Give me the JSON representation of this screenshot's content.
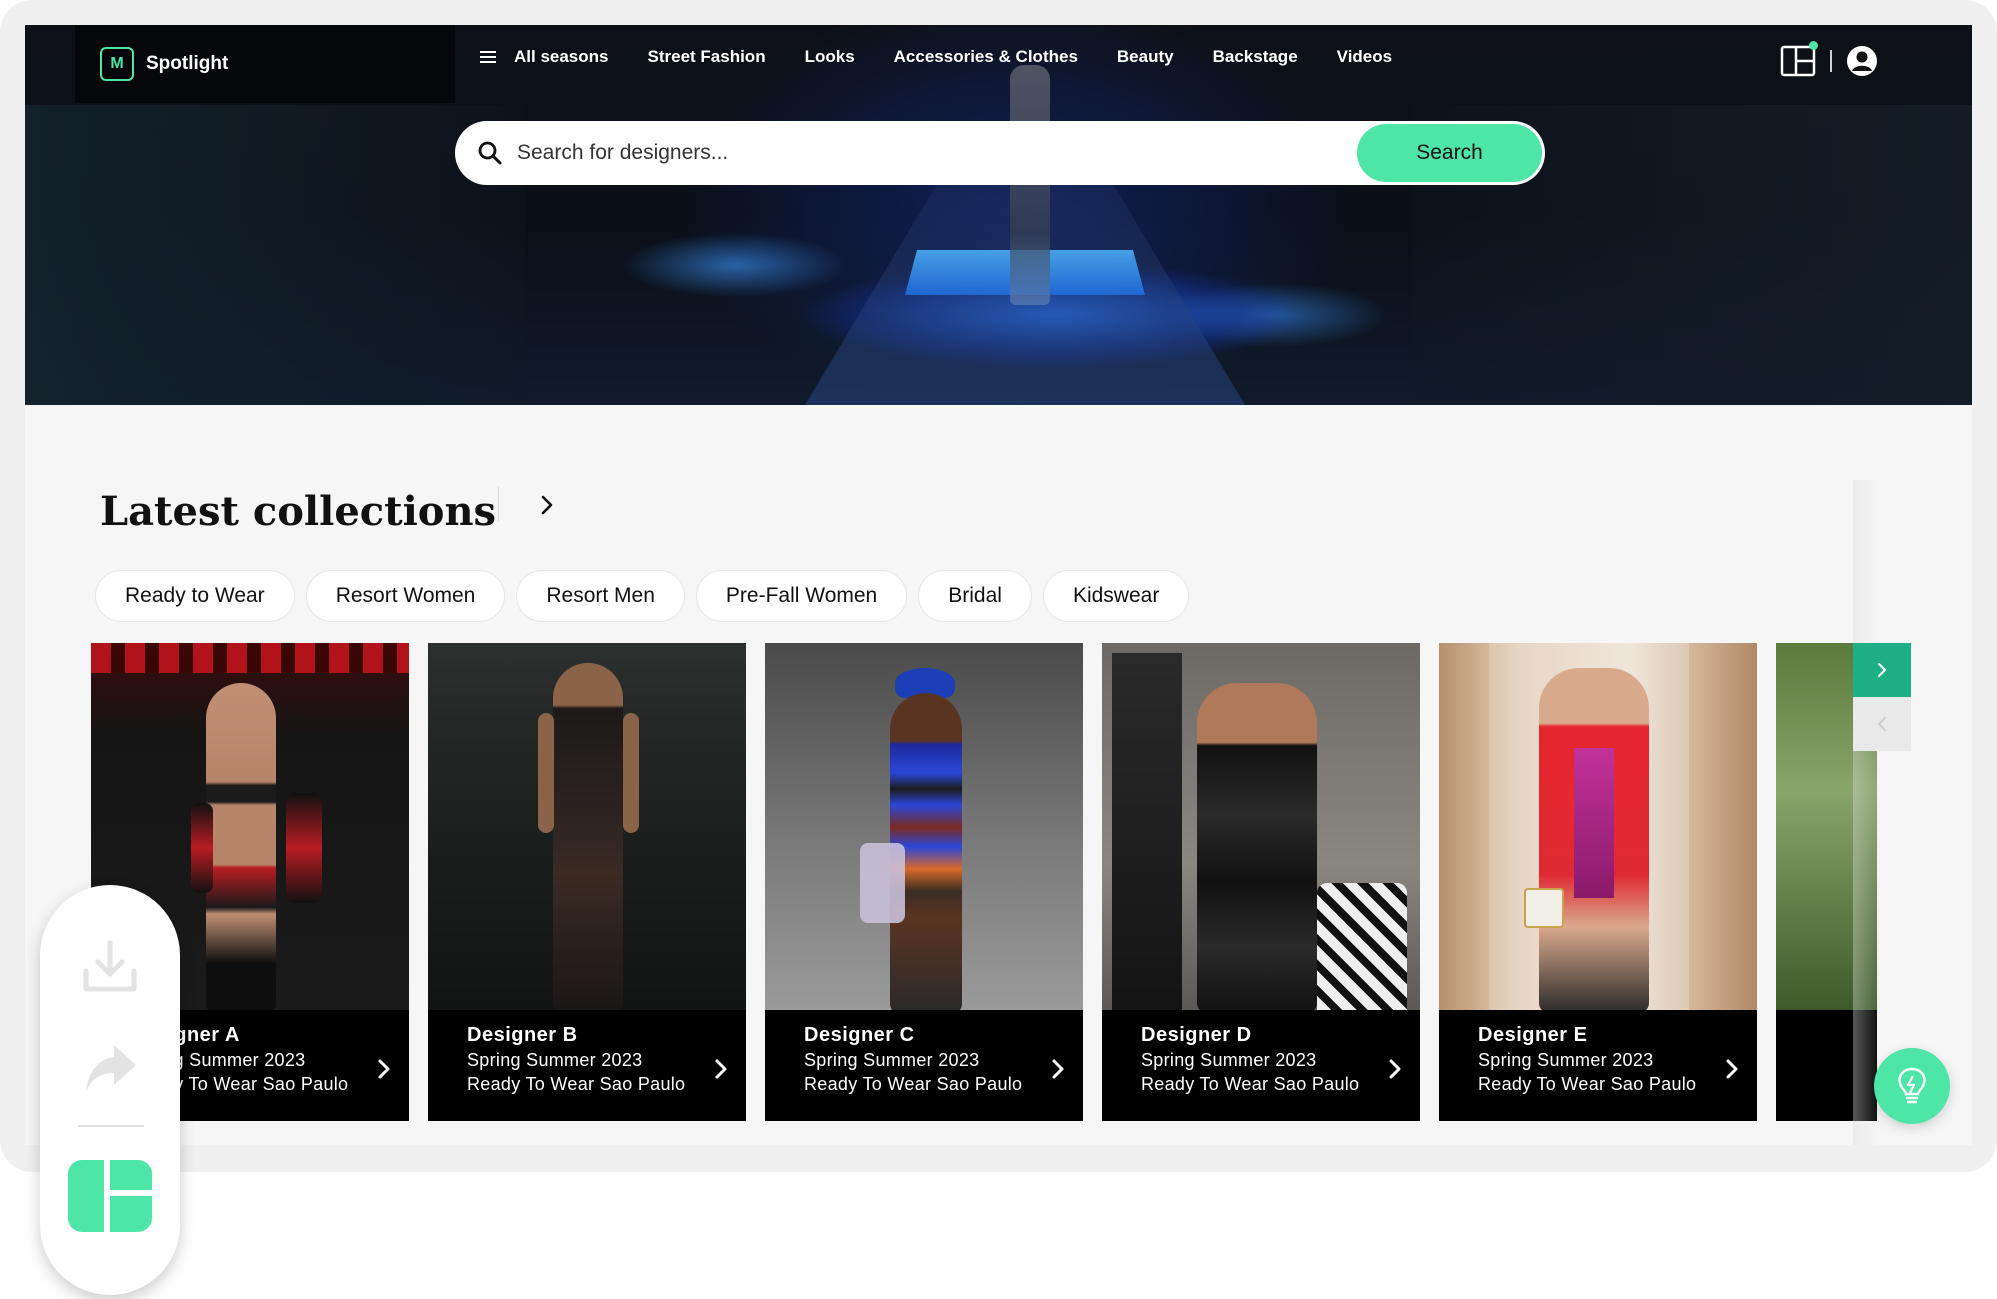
{
  "brand": {
    "name": "Spotlight",
    "mark": "M"
  },
  "nav": {
    "items": [
      "All seasons",
      "Street Fashion",
      "Looks",
      "Accessories & Clothes",
      "Beauty",
      "Backstage",
      "Videos"
    ]
  },
  "search": {
    "placeholder": "Search for designers...",
    "button_label": "Search"
  },
  "section": {
    "title": "Latest collections"
  },
  "chips": [
    "Ready to Wear",
    "Resort Women",
    "Resort Men",
    "Pre-Fall Women",
    "Bridal",
    "Kidswear"
  ],
  "cards": [
    {
      "name": "Designer  A",
      "season": "Spring Summer 2023",
      "line": "Ready To Wear Sao Paulo"
    },
    {
      "name": "Designer  B",
      "season": "Spring Summer 2023",
      "line": "Ready To Wear Sao Paulo"
    },
    {
      "name": "Designer  C",
      "season": "Spring Summer 2023",
      "line": "Ready To Wear Sao Paulo"
    },
    {
      "name": "Designer  D",
      "season": "Spring Summer 2023",
      "line": "Ready To Wear Sao Paulo"
    },
    {
      "name": "Designer  E",
      "season": "Spring Summer 2023",
      "line": "Ready To Wear Sao Paulo"
    }
  ],
  "colors": {
    "accent": "#4ee6a6",
    "accent_dark": "#1faf85",
    "card_bg": "#000000"
  },
  "icons": {
    "menu": "hamburger-icon",
    "layout": "layout-icon",
    "user": "user-icon",
    "search": "search-icon",
    "next": "chevron-right-icon",
    "prev": "chevron-left-icon",
    "help": "lightbulb-icon",
    "download": "download-icon",
    "share": "share-icon",
    "dashboard": "dashboard-icon"
  }
}
